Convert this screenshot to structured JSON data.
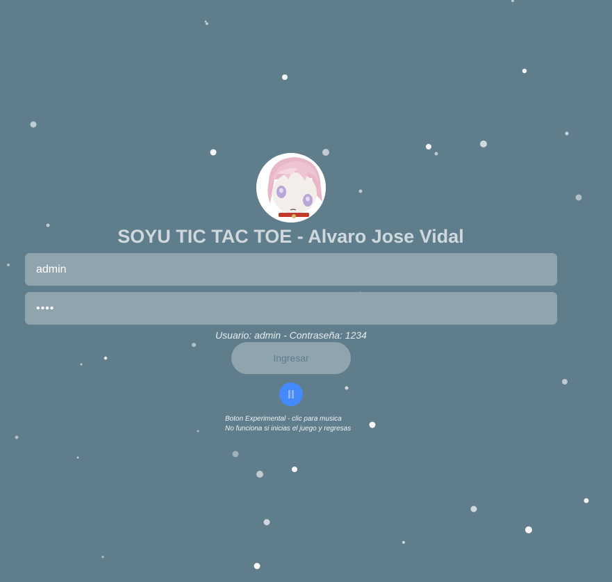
{
  "page": {
    "title": "SOYU TIC TAC TOE - Alvaro Jose Vidal",
    "background_color": "#607d8b"
  },
  "avatar": {
    "icon": "anime-character-avatar"
  },
  "login": {
    "username_value": "admin",
    "password_value": "1234",
    "hint": "Usuario: admin  -  Contraseña: 1234",
    "submit_label": "Ingresar"
  },
  "music": {
    "icon": "pause-icon",
    "note_line1": "Boton Experimental - clic para musica",
    "note_line2": "No funciona si inicias el juego y regresas",
    "button_color": "#448aff"
  }
}
